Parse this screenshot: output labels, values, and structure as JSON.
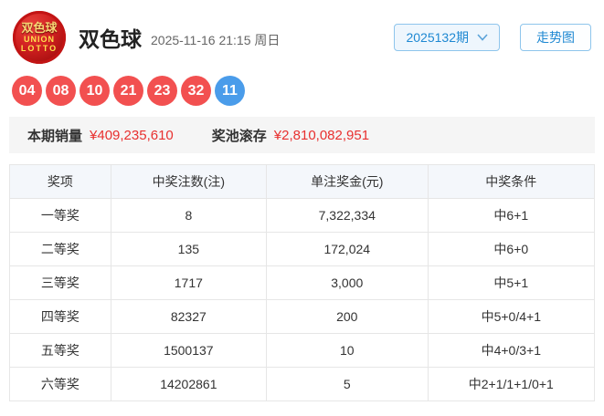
{
  "header": {
    "logo": {
      "line1": "双色球",
      "line2": "UNION",
      "line3": "LOTTO"
    },
    "title": "双色球",
    "datetime": "2025-11-16 21:15 周日",
    "period_button_label": "2025132期",
    "trend_button_label": "走势图"
  },
  "balls": {
    "red": [
      "04",
      "08",
      "10",
      "21",
      "23",
      "32"
    ],
    "blue": [
      "11"
    ]
  },
  "sales": {
    "sales_label": "本期销量",
    "sales_value": "¥409,235,610",
    "pool_label": "奖池滚存",
    "pool_value": "¥2,810,082,951"
  },
  "table": {
    "headers": [
      "奖项",
      "中奖注数(注)",
      "单注奖金(元)",
      "中奖条件"
    ],
    "rows": [
      [
        "一等奖",
        "8",
        "7,322,334",
        "中6+1"
      ],
      [
        "二等奖",
        "135",
        "172,024",
        "中6+0"
      ],
      [
        "三等奖",
        "1717",
        "3,000",
        "中5+1"
      ],
      [
        "四等奖",
        "82327",
        "200",
        "中5+0/4+1"
      ],
      [
        "五等奖",
        "1500137",
        "10",
        "中4+0/3+1"
      ],
      [
        "六等奖",
        "14202861",
        "5",
        "中2+1/1+1/0+1"
      ]
    ]
  },
  "colors": {
    "red_ball": "#f25050",
    "blue_ball": "#4a9cea",
    "accent_red": "#e8302f",
    "accent_blue": "#1e88d2"
  }
}
